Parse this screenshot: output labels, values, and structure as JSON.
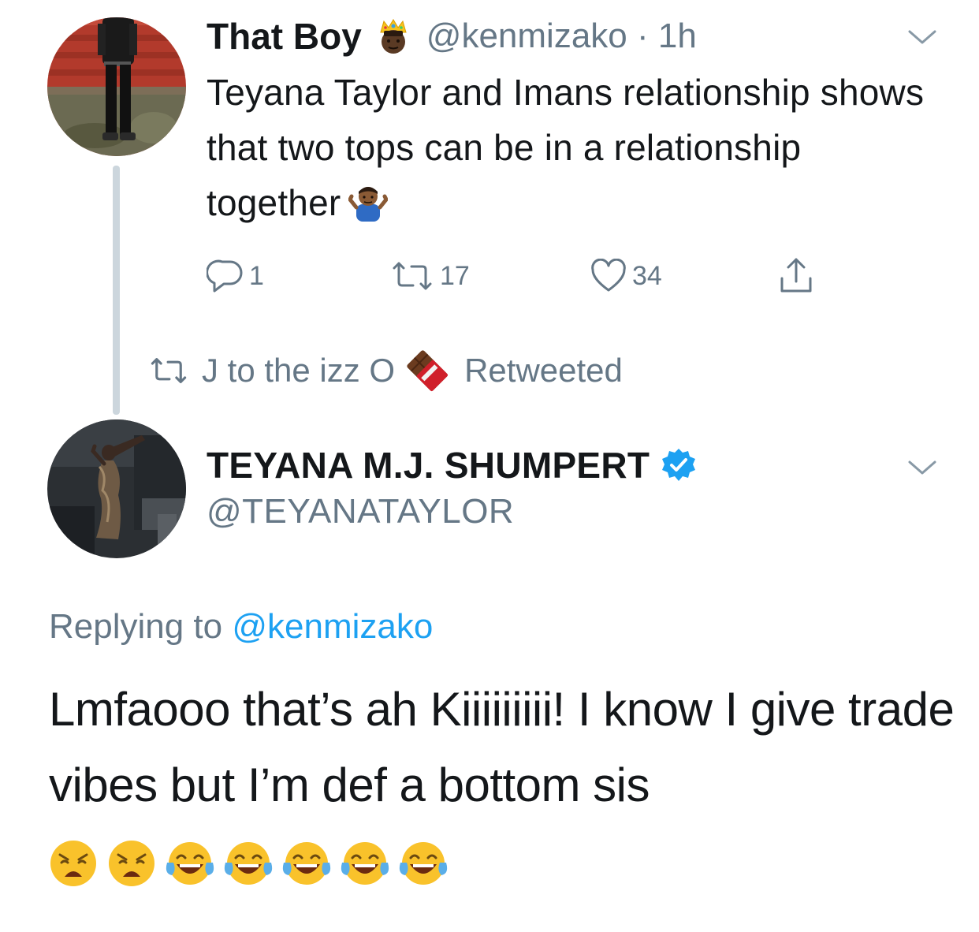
{
  "first_tweet": {
    "display_name": "That Boy",
    "name_emoji": "crown-face-emoji",
    "handle_time": "@kenmizako · 1h",
    "text": "Teyana Taylor and Imans relationship shows that two tops can be in a relationship together",
    "trailing_emoji": "person-shrugging-emoji",
    "replies": "1",
    "retweets": "17",
    "likes": "34"
  },
  "retweet_context": {
    "name": "J to the izz O",
    "emoji": "chocolate-bar-emoji",
    "label": "Retweeted"
  },
  "second_tweet": {
    "display_name": "TEYANA M.J. SHUMPERT",
    "verified": true,
    "handle": "@TEYANATAYLOR",
    "replying_prefix": "Replying to",
    "replying_mention": "@kenmizako",
    "text": "Lmfaooo that’s ah Kiiiiiiiii! I know I give trade vibes but I’m def a bottom sis",
    "emojis": [
      "weary-face-emoji",
      "weary-face-emoji",
      "tears-of-joy-emoji",
      "tears-of-joy-emoji",
      "tears-of-joy-emoji",
      "tears-of-joy-emoji",
      "tears-of-joy-emoji"
    ]
  },
  "colors": {
    "text_primary": "#14171a",
    "text_secondary": "#657786",
    "link": "#1da1f2",
    "thread_line": "#ccd6dd",
    "verified": "#1da1f2"
  }
}
